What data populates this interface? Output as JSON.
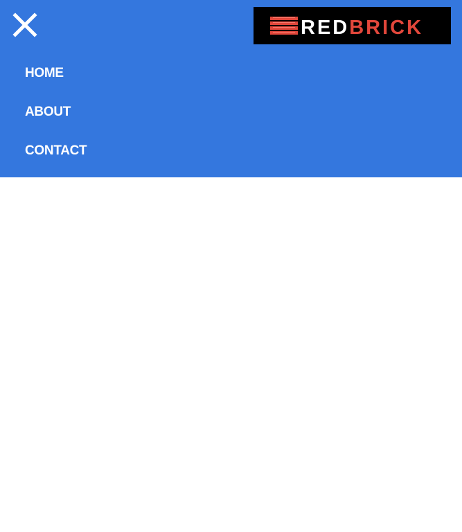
{
  "header": {
    "close_icon": "close-icon",
    "logo": {
      "text_red_part_1": "RED",
      "text_red_part_2": "BRICK",
      "text_color_1": "#ffffff",
      "text_color_2": "#e2473b",
      "background": "#000000"
    }
  },
  "nav": {
    "items": [
      {
        "label": "HOME"
      },
      {
        "label": "ABOUT"
      },
      {
        "label": "CONTACT"
      }
    ]
  },
  "colors": {
    "menu_background": "#3477de",
    "nav_text": "#ffffff",
    "page_background": "#ffffff"
  }
}
